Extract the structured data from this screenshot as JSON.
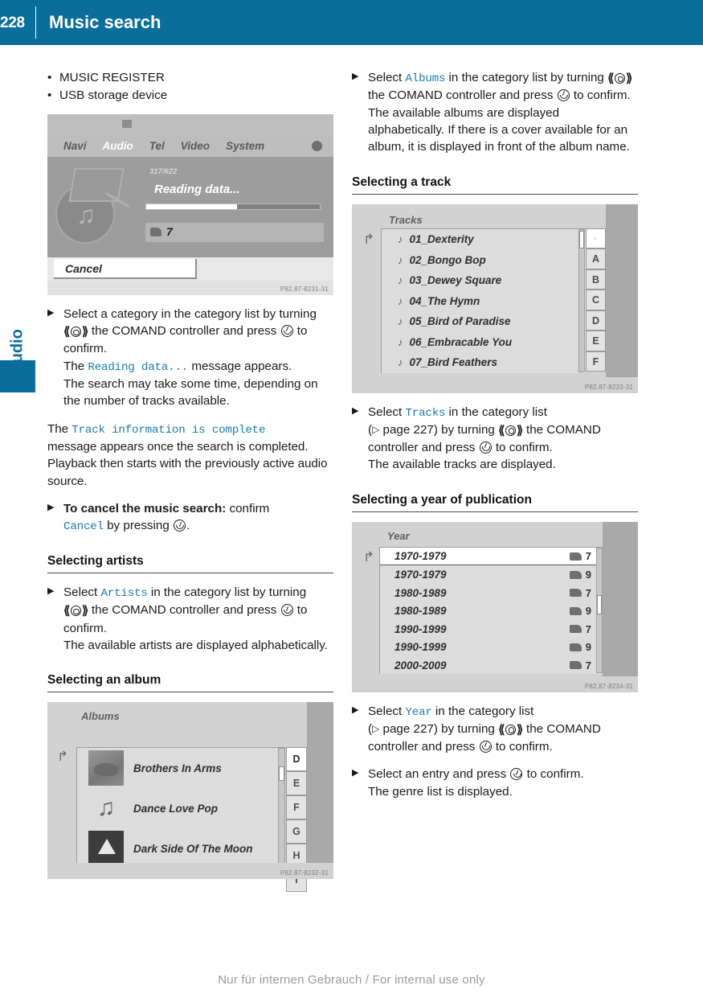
{
  "header": {
    "page_number": "228",
    "title": "Music search",
    "accent_color": "#0A6E9D"
  },
  "side_tab": {
    "label": "Audio"
  },
  "left_column": {
    "bullets": [
      {
        "dot": "•",
        "text": "MUSIC REGISTER"
      },
      {
        "dot": "•",
        "text": "USB storage device"
      }
    ],
    "figure_reading": {
      "menu": [
        {
          "label": "Navi",
          "active": false
        },
        {
          "label": "Audio",
          "active": true
        },
        {
          "label": "Tel",
          "active": false
        },
        {
          "label": "Video",
          "active": false
        },
        {
          "label": "System",
          "active": false
        }
      ],
      "track_counter": "317/622",
      "status_message": "Reading data...",
      "progress_percent": 52,
      "slot_number": "7",
      "cancel_label": "Cancel",
      "caption": "P82.87-8231-31"
    },
    "step_select_category": {
      "t1": "Select a category in the category list by turning ",
      "t2": " the COMAND controller and press ",
      "t3": " to confirm.",
      "t4": "The ",
      "code1": "Reading data...",
      "t5": " message appears.",
      "t6": "The search may take some time, depending on the number of tracks available."
    },
    "para_complete": {
      "t1": "The ",
      "code1": "Track information is complete",
      "t2": " message appears once the search is completed. Playback then starts with the previously active audio source."
    },
    "step_cancel": {
      "bold": "To cancel the music search:",
      "t1": " confirm ",
      "code1": "Cancel",
      "t2": " by pressing ",
      "t3": "."
    },
    "heading_artists": "Selecting artists",
    "step_artists": {
      "t1": "Select ",
      "code1": "Artists",
      "t2": " in the category list by turning ",
      "t3": " the COMAND controller and press ",
      "t4": " to confirm.",
      "t5": "The available artists are displayed alphabetically."
    },
    "heading_album": "Selecting an album",
    "figure_albums": {
      "title": "Albums",
      "rows": [
        {
          "name": "Brothers In Arms",
          "art": "cover-photo"
        },
        {
          "name": "Dance Love Pop",
          "art": "music-note"
        },
        {
          "name": "Dark Side Of The Moon",
          "art": "cover-prism"
        }
      ],
      "letters": [
        "D",
        "E",
        "F",
        "G",
        "H",
        "I"
      ],
      "current_letter": "D",
      "caption": "P82.87-8232-31"
    }
  },
  "right_column": {
    "step_albums": {
      "t1": "Select ",
      "code1": "Albums",
      "t2": " in the category list by turning ",
      "t3": " the COMAND controller and press ",
      "t4": " to confirm.",
      "t5": "The available albums are displayed alphabetically. If there is a cover available for an album, it is displayed in front of the album name."
    },
    "heading_track": "Selecting a track",
    "figure_tracks": {
      "title": "Tracks",
      "rows": [
        "01_Dexterity",
        "02_Bongo Bop",
        "03_Dewey Square",
        "04_The Hymn",
        "05_Bird of Paradise",
        "06_Embracable You",
        "07_Bird Feathers"
      ],
      "letters": [
        "A",
        "B",
        "C",
        "D",
        "E",
        "F"
      ],
      "caption": "P82.87-8233-31"
    },
    "step_tracks": {
      "t1": "Select ",
      "code1": "Tracks",
      "t2": " in the category list",
      "t3": "(",
      "ref": " page 227",
      "t4": ") by turning ",
      "t5": " the COMAND controller and press ",
      "t6": " to confirm.",
      "t7": "The available tracks are displayed."
    },
    "heading_year": "Selecting a year of publication",
    "figure_year": {
      "title": "Year",
      "rows": [
        {
          "range": "1970-1979",
          "count": "7",
          "selected": true
        },
        {
          "range": "1970-1979",
          "count": "9",
          "selected": false
        },
        {
          "range": "1980-1989",
          "count": "7",
          "selected": false
        },
        {
          "range": "1980-1989",
          "count": "9",
          "selected": false
        },
        {
          "range": "1990-1999",
          "count": "7",
          "selected": false
        },
        {
          "range": "1990-1999",
          "count": "9",
          "selected": false
        },
        {
          "range": "2000-2009",
          "count": "7",
          "selected": false
        }
      ],
      "caption": "P82.87-8234-31"
    },
    "step_year": {
      "t1": "Select ",
      "code1": "Year",
      "t2": " in the category list",
      "t3": "(",
      "ref": " page 227",
      "t4": ") by turning ",
      "t5": " the COMAND controller and press ",
      "t6": " to confirm."
    },
    "step_entry": {
      "t1": "Select an entry and press ",
      "t2": " to confirm.",
      "t3": "The genre list is displayed."
    }
  },
  "footer": {
    "text": "Nur für internen Gebrauch / For internal use only"
  }
}
